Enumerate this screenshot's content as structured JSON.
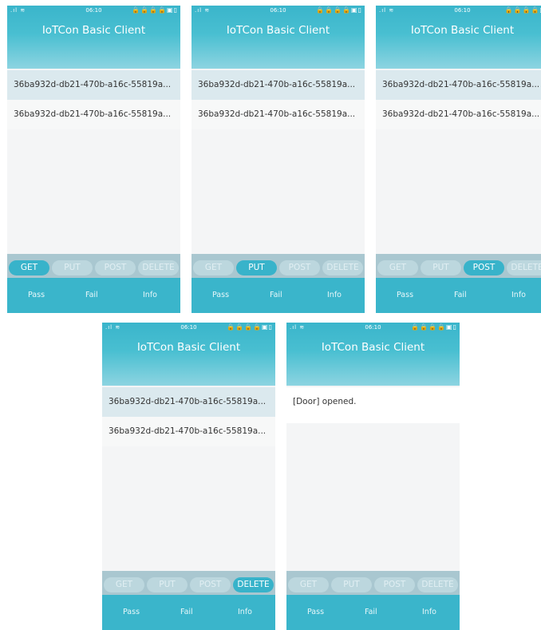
{
  "screens": [
    {
      "status": {
        "signal": ".ıl ≋",
        "time": "06:10",
        "icons": "🔒🔒🔒🔒▣▯"
      },
      "title": "IoTCon Basic Client",
      "rows": [
        "36ba932d-db21-470b-a16c-55819a...",
        "36ba932d-db21-470b-a16c-55819a..."
      ],
      "buttons": [
        "GET",
        "PUT",
        "POST",
        "DELETE"
      ],
      "active_button": "GET",
      "footer": [
        "Pass",
        "Fail",
        "Info"
      ]
    },
    {
      "status": {
        "signal": ".ıl ≋",
        "time": "06:10",
        "icons": "🔒🔒🔒🔒▣▯"
      },
      "title": "IoTCon Basic Client",
      "rows": [
        "36ba932d-db21-470b-a16c-55819a...",
        "36ba932d-db21-470b-a16c-55819a..."
      ],
      "buttons": [
        "GET",
        "PUT",
        "POST",
        "DELETE"
      ],
      "active_button": "PUT",
      "footer": [
        "Pass",
        "Fail",
        "Info"
      ]
    },
    {
      "status": {
        "signal": ".ıl ≋",
        "time": "06:10",
        "icons": "🔒🔒🔒🔒▣"
      },
      "title": "IoTCon Basic Client",
      "rows": [
        "36ba932d-db21-470b-a16c-55819a...",
        "36ba932d-db21-470b-a16c-55819a..."
      ],
      "buttons": [
        "GET",
        "PUT",
        "POST",
        "DELETE"
      ],
      "active_button": "POST",
      "footer": [
        "Pass",
        "Fail",
        "Info"
      ]
    },
    {
      "status": {
        "signal": ".ıl ≋",
        "time": "06:10",
        "icons": "🔒🔒🔒🔒▣▯"
      },
      "title": "IoTCon Basic Client",
      "rows": [
        "36ba932d-db21-470b-a16c-55819a...",
        "36ba932d-db21-470b-a16c-55819a..."
      ],
      "buttons": [
        "GET",
        "PUT",
        "POST",
        "DELETE"
      ],
      "active_button": "DELETE",
      "footer": [
        "Pass",
        "Fail",
        "Info"
      ]
    },
    {
      "status": {
        "signal": ".ıl ≋",
        "time": "06:10",
        "icons": "🔒🔒🔒🔒▣▯"
      },
      "title": "IoTCon Basic Client",
      "message": "[Door] opened.",
      "buttons": [
        "GET",
        "PUT",
        "POST",
        "DELETE"
      ],
      "active_button": "",
      "footer": [
        "Pass",
        "Fail",
        "Info"
      ]
    }
  ],
  "colors": {
    "accent": "#3ab5cb",
    "button_inactive": "#bcd7de",
    "row_selected": "#dbe9ee"
  }
}
